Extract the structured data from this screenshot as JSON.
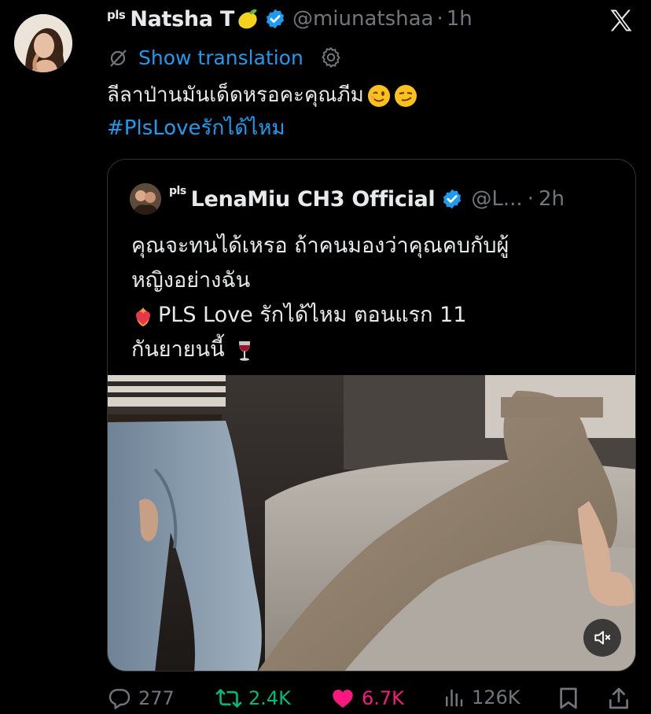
{
  "author": {
    "pls_tag": "pls",
    "name": "Natsha T",
    "handle": "@miunatshaa",
    "separator": "·",
    "time": "1h"
  },
  "translation": {
    "label": "Show translation"
  },
  "tweet": {
    "text_line1": "ลีลาป่านมันเด็ดหรอคะคุณภีม",
    "hashtag": "#PlsLoveรักได้ไหม"
  },
  "quote": {
    "pls_tag": "pls",
    "name": "LenaMiu CH3 Official",
    "handle": "@L...",
    "separator": "·",
    "time": "2h",
    "line1": "คุณจะทนได้เหรอ ถ้าคนมองว่าคุณคบกับผู้",
    "line2": "หญิงอย่างฉัน",
    "line3": "PLS Love รักได้ไหม ตอนแรก 11",
    "line4": "กันยายนนี้"
  },
  "actions": {
    "replies": "277",
    "retweets": "2.4K",
    "likes": "6.7K",
    "views": "126K"
  },
  "icons": {
    "close": "x-logo-icon",
    "translate": "translate-icon",
    "settings": "gear-icon",
    "verified": "verified-badge-icon",
    "reply": "reply-icon",
    "retweet": "retweet-icon",
    "like": "heart-icon",
    "views": "views-icon",
    "bookmark": "bookmark-icon",
    "share": "share-icon",
    "mute": "speaker-icon"
  },
  "colors": {
    "background": "#000000",
    "link": "#1d9bf0",
    "muted": "#71767b",
    "retweet": "#00ba7c",
    "like": "#f91880"
  }
}
